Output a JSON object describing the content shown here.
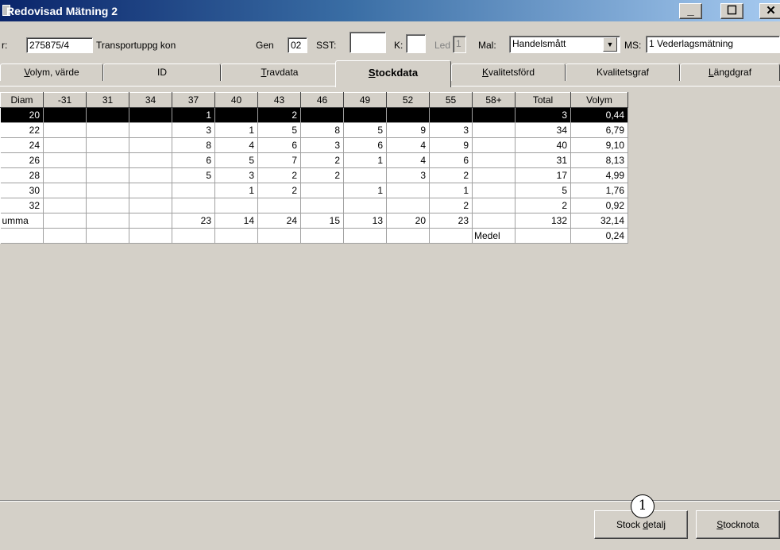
{
  "window": {
    "title": "Redovisad Mätning 2",
    "minimize_glyph": "_",
    "maximize_glyph": "☐",
    "close_glyph": "✕"
  },
  "infobar": {
    "nr_label": "r:",
    "nr_value": "275875/4",
    "transport_label": "Transportuppg kon",
    "gen_label": "Gen",
    "gen_value": "02",
    "sst_label": "SST:",
    "sst_value": "",
    "k_label": "K:",
    "k_value": "",
    "led_label": "Led",
    "led_value": "1",
    "mal_label": "Mal:",
    "mal_value": "Handelsmått",
    "ms_label": "MS:",
    "ms_value": "1 Vederlagsmätning"
  },
  "tabs": [
    {
      "prefix": "",
      "ul": "V",
      "rest": "olym, värde"
    },
    {
      "prefix": "",
      "ul": "",
      "rest": "ID"
    },
    {
      "prefix": "",
      "ul": "T",
      "rest": "ravdata"
    },
    {
      "prefix": "",
      "ul": "S",
      "rest": "tockdata"
    },
    {
      "prefix": "",
      "ul": "K",
      "rest": "valitetsförd"
    },
    {
      "prefix": "Kvalitets",
      "ul": "g",
      "rest": "raf"
    },
    {
      "prefix": "",
      "ul": "L",
      "rest": "ängdgraf"
    }
  ],
  "active_tab_index": 3,
  "table": {
    "headers": [
      "Diam",
      "-31",
      "31",
      "34",
      "37",
      "40",
      "43",
      "46",
      "49",
      "52",
      "55",
      "58+",
      "Total",
      "Volym"
    ],
    "rows": [
      [
        "20",
        "",
        "",
        "",
        "1",
        "",
        "2",
        "",
        "",
        "",
        "",
        "",
        "3",
        "0,44"
      ],
      [
        "22",
        "",
        "",
        "",
        "3",
        "1",
        "5",
        "8",
        "5",
        "9",
        "3",
        "",
        "34",
        "6,79"
      ],
      [
        "24",
        "",
        "",
        "",
        "8",
        "4",
        "6",
        "3",
        "6",
        "4",
        "9",
        "",
        "40",
        "9,10"
      ],
      [
        "26",
        "",
        "",
        "",
        "6",
        "5",
        "7",
        "2",
        "1",
        "4",
        "6",
        "",
        "31",
        "8,13"
      ],
      [
        "28",
        "",
        "",
        "",
        "5",
        "3",
        "2",
        "2",
        "",
        "3",
        "2",
        "",
        "17",
        "4,99"
      ],
      [
        "30",
        "",
        "",
        "",
        "",
        "1",
        "2",
        "",
        "1",
        "",
        "1",
        "",
        "5",
        "1,76"
      ],
      [
        "32",
        "",
        "",
        "",
        "",
        "",
        "",
        "",
        "",
        "",
        "2",
        "",
        "2",
        "0,92"
      ],
      [
        "umma",
        "",
        "",
        "",
        "23",
        "14",
        "24",
        "15",
        "13",
        "20",
        "23",
        "",
        "132",
        "32,14"
      ],
      [
        "",
        "",
        "",
        "",
        "",
        "",
        "",
        "",
        "",
        "",
        "",
        "Medel",
        "",
        "0,24"
      ]
    ],
    "selected_row_index": 0
  },
  "buttons": {
    "stock_detalj_pre": "Stock ",
    "stock_detalj_ul": "d",
    "stock_detalj_post": "etalj",
    "stocknota_ul": "S",
    "stocknota_post": "tocknota"
  },
  "marker_label": "1"
}
